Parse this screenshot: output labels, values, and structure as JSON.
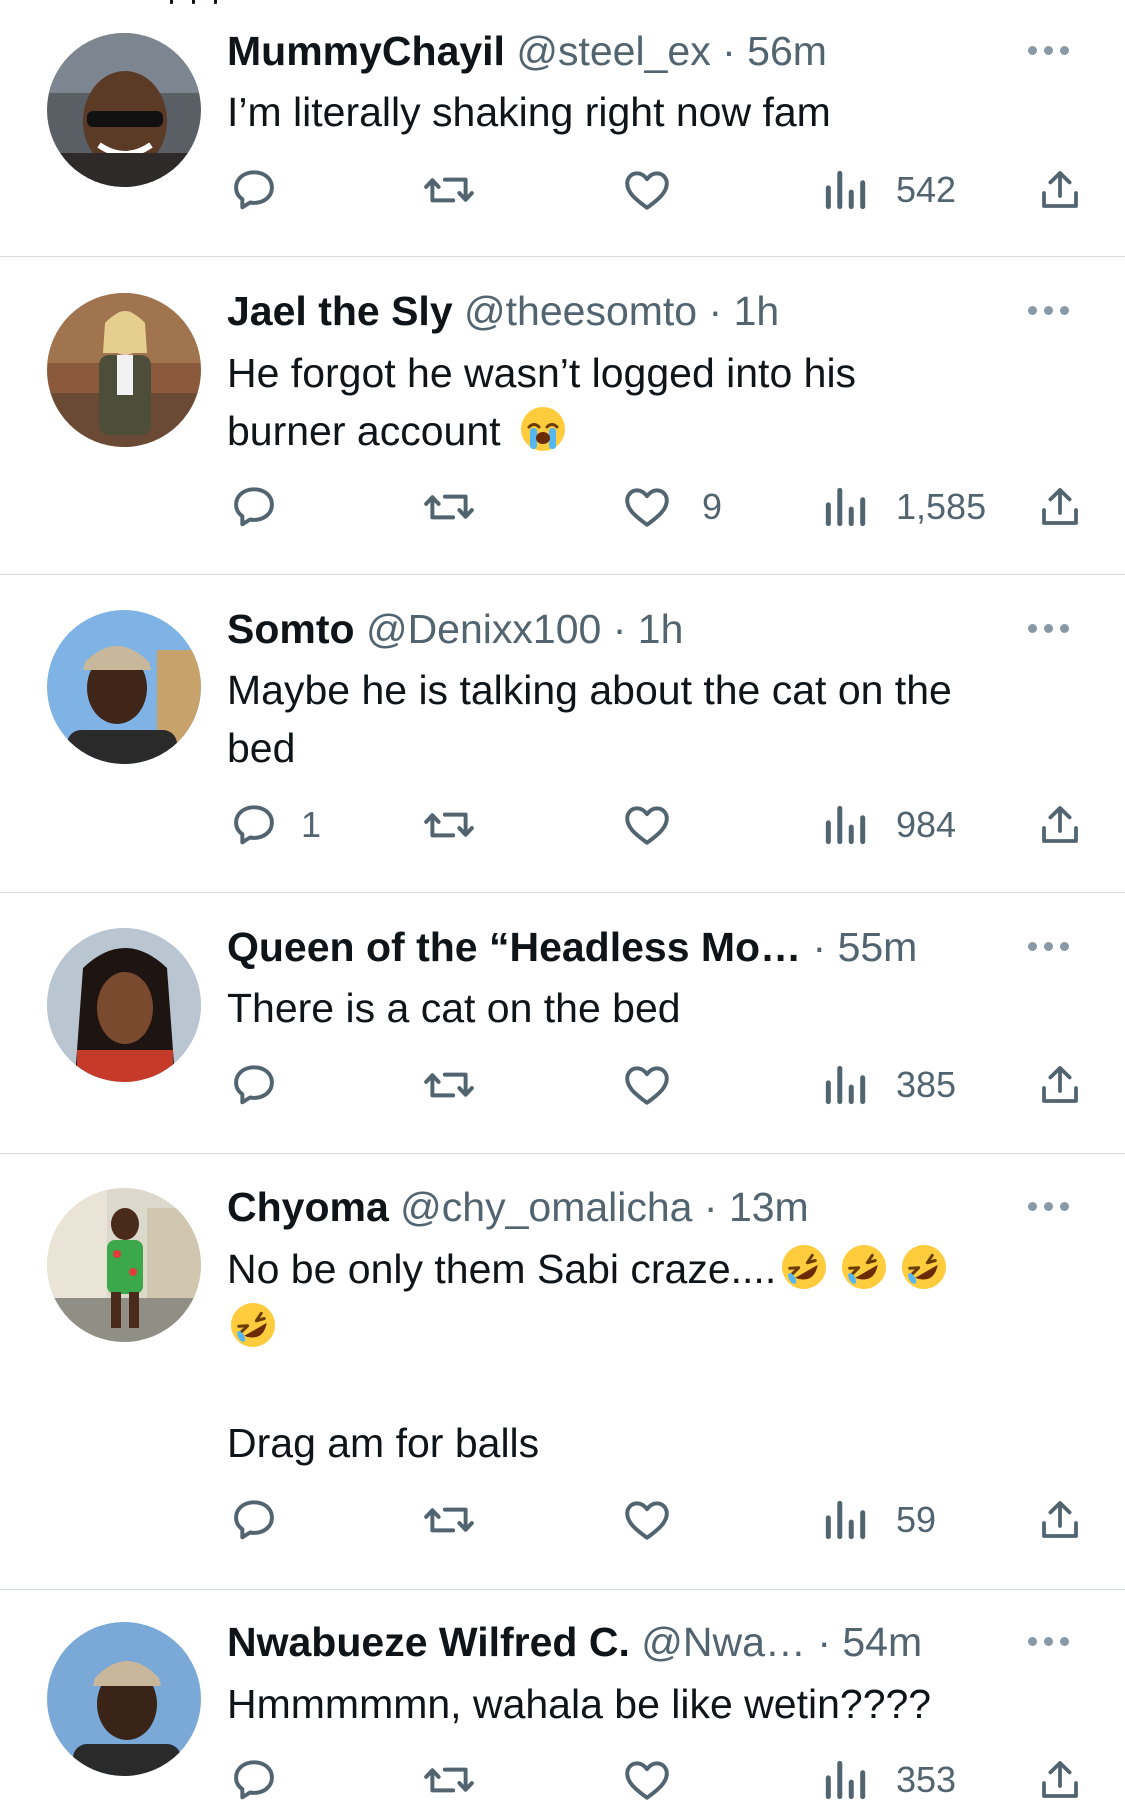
{
  "icons": {
    "reply": "reply-icon",
    "retweet": "retweet-icon",
    "like": "heart-icon",
    "views": "views-icon",
    "share": "share-icon",
    "more": "more-icon"
  },
  "colors": {
    "text": "#0f1419",
    "secondary": "#536471",
    "divider": "#d5dbe0",
    "icon": "#536471"
  },
  "tweets": [
    {
      "name": "MummyChayil",
      "handle": "@steel_ex",
      "dot": "·",
      "time": "56m",
      "lines": [
        "I’m literally shaking right now fam"
      ],
      "replies": "",
      "retweets": "",
      "likes": "",
      "views": "542"
    },
    {
      "name": "Jael the Sly",
      "handle": "@theesomto",
      "dot": "·",
      "time": "1h",
      "lines": [
        "He forgot he wasn’t logged into his",
        "burner account"
      ],
      "emoji": "loudly-crying-face-emoji",
      "replies": "",
      "retweets": "",
      "likes": "9",
      "views": "1,585"
    },
    {
      "name": "Somto",
      "handle": "@Denixx100",
      "dot": "·",
      "time": "1h",
      "lines": [
        "Maybe he is talking about the cat on the",
        "bed"
      ],
      "replies": "1",
      "retweets": "",
      "likes": "",
      "views": "984"
    },
    {
      "name": "Queen of the “Headless Mo…",
      "handle": "",
      "dot": "·",
      "time": "55m",
      "lines": [
        "There is a cat on the bed"
      ],
      "replies": "",
      "retweets": "",
      "likes": "",
      "views": "385"
    },
    {
      "name": "Chyoma",
      "handle": "@chy_omalicha",
      "dot": "·",
      "time": "13m",
      "lines": [
        "No be only them Sabi craze....",
        "",
        "",
        "Drag am for balls"
      ],
      "emoji": "rolling-on-the-floor-laughing-emoji",
      "replies": "",
      "retweets": "",
      "likes": "",
      "views": "59"
    },
    {
      "name": "Nwabueze Wilfred C.",
      "handle": "@Nwa…",
      "dot": "·",
      "time": "54m",
      "lines": [
        "Hmmmmmn, wahala be like wetin????"
      ],
      "replies": "",
      "retweets": "",
      "likes": "",
      "views": "353"
    }
  ]
}
